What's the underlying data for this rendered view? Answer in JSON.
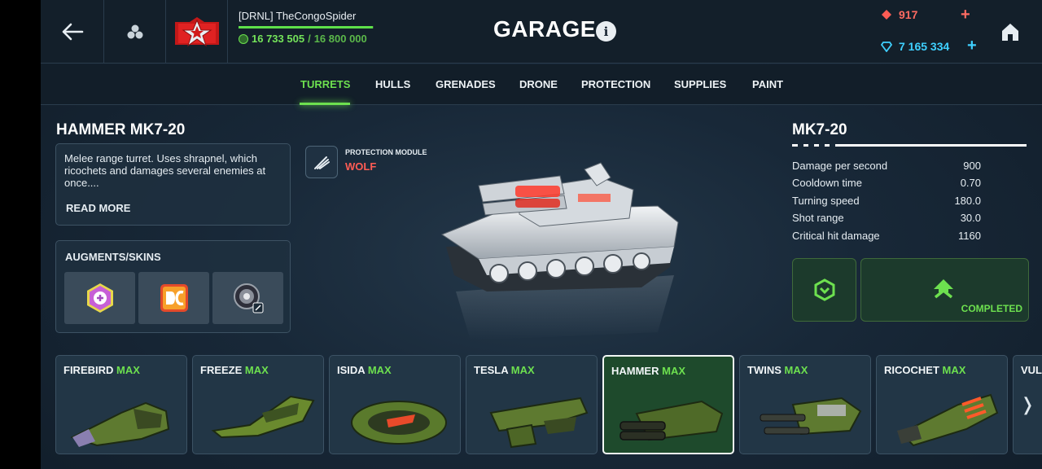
{
  "header": {
    "title": "GARAGE",
    "info_glyph": "i",
    "player_name": "[DRNL] TheCongoSpider",
    "xp_current": "16 733 505",
    "xp_separator": " / ",
    "xp_max": "16 800 000",
    "xp_progress": 0.996,
    "rubies": "917",
    "crystals": "7 165 334",
    "add_glyph": "+",
    "icons": [
      "back-arrow-icon",
      "group-icon",
      "rank-insignia-icon",
      "xp-icon",
      "ruby-icon",
      "crystal-icon",
      "home-icon"
    ]
  },
  "tabs": [
    {
      "label": "TURRETS",
      "active": true
    },
    {
      "label": "HULLS"
    },
    {
      "label": "GRENADES"
    },
    {
      "label": "DRONE"
    },
    {
      "label": "PROTECTION"
    },
    {
      "label": "SUPPLIES"
    },
    {
      "label": "PAINT"
    }
  ],
  "item": {
    "name": "HAMMER MK7-20",
    "description": "Melee range turret. Uses shrapnel, which ricochets and damages several enemies at once....",
    "read_more": "READ MORE",
    "augments_title": "AUGMENTS/SKINS",
    "augment_slots": [
      "augment-icon",
      "dc-skin-icon",
      "module-icon"
    ]
  },
  "protection_module": {
    "label": "PROTECTION MODULE",
    "name": "WOLF"
  },
  "stats": {
    "title": "MK7-20",
    "rows": [
      {
        "label": "Damage per second",
        "value": "900"
      },
      {
        "label": "Cooldown time",
        "value": "0.70"
      },
      {
        "label": "Turning speed",
        "value": "180.0"
      },
      {
        "label": "Shot range",
        "value": "30.0"
      },
      {
        "label": "Critical hit damage",
        "value": "1160"
      }
    ],
    "status": "COMPLETED"
  },
  "turrets": [
    {
      "name": "FIREBIRD",
      "tag": "MAX"
    },
    {
      "name": "FREEZE",
      "tag": "MAX"
    },
    {
      "name": "ISIDA",
      "tag": "MAX"
    },
    {
      "name": "TESLA",
      "tag": "MAX"
    },
    {
      "name": "HAMMER",
      "tag": "MAX",
      "selected": true
    },
    {
      "name": "TWINS",
      "tag": "MAX"
    },
    {
      "name": "RICOCHET",
      "tag": "MAX"
    },
    {
      "name": "VUL",
      "tag": ""
    }
  ],
  "colors": {
    "accent_green": "#6de04f",
    "ruby": "#ff6b62",
    "crystal": "#3fd0ff",
    "module_red": "#ff5c54"
  }
}
